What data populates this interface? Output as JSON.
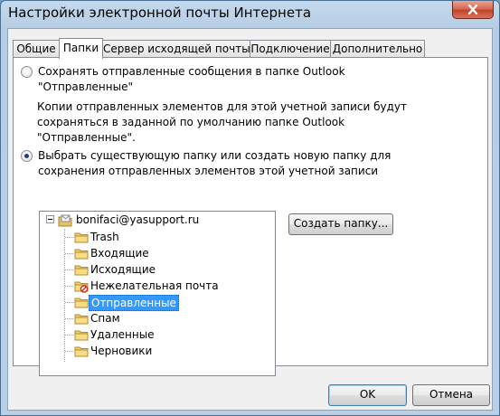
{
  "window": {
    "title": "Настройки электронной почты Интернета",
    "close_label": "Закрыть"
  },
  "tabs": [
    {
      "label": "Общие"
    },
    {
      "label": "Папки"
    },
    {
      "label": "Сервер исходящей почты"
    },
    {
      "label": "Подключение"
    },
    {
      "label": "Дополнительно"
    }
  ],
  "active_tab": "Папки",
  "option1": {
    "line1": "Сохранять отправленные сообщения в папке Outlook",
    "line2": "\"Отправленные\"",
    "checked": false,
    "desc_line1": "Копии отправленных элементов для этой учетной записи будут",
    "desc_line2": "сохраняться в заданной по умолчанию папке Outlook",
    "desc_line3": "\"Отправленные\"."
  },
  "option2": {
    "line1": "Выбрать существующую папку или создать новую папку для",
    "line2": "сохранения отправленных элементов этой учетной записи",
    "checked": true
  },
  "tree": {
    "root": "bonifaci@yasupport.ru",
    "folders": [
      {
        "label": "Trash",
        "icon": "folder-icon"
      },
      {
        "label": "Входящие",
        "icon": "folder-icon"
      },
      {
        "label": "Исходящие",
        "icon": "folder-icon"
      },
      {
        "label": "Нежелательная почта",
        "icon": "junk-folder-icon"
      },
      {
        "label": "Отправленные",
        "icon": "folder-icon",
        "selected": true
      },
      {
        "label": "Спам",
        "icon": "folder-icon"
      },
      {
        "label": "Удаленные",
        "icon": "folder-icon"
      },
      {
        "label": "Черновики",
        "icon": "folder-icon"
      }
    ]
  },
  "buttons": {
    "new_folder": "Создать папку...",
    "ok": "OK",
    "cancel": "Отмена"
  },
  "colors": {
    "selection": "#3399ff",
    "radio_dot": "#1f3f78"
  }
}
